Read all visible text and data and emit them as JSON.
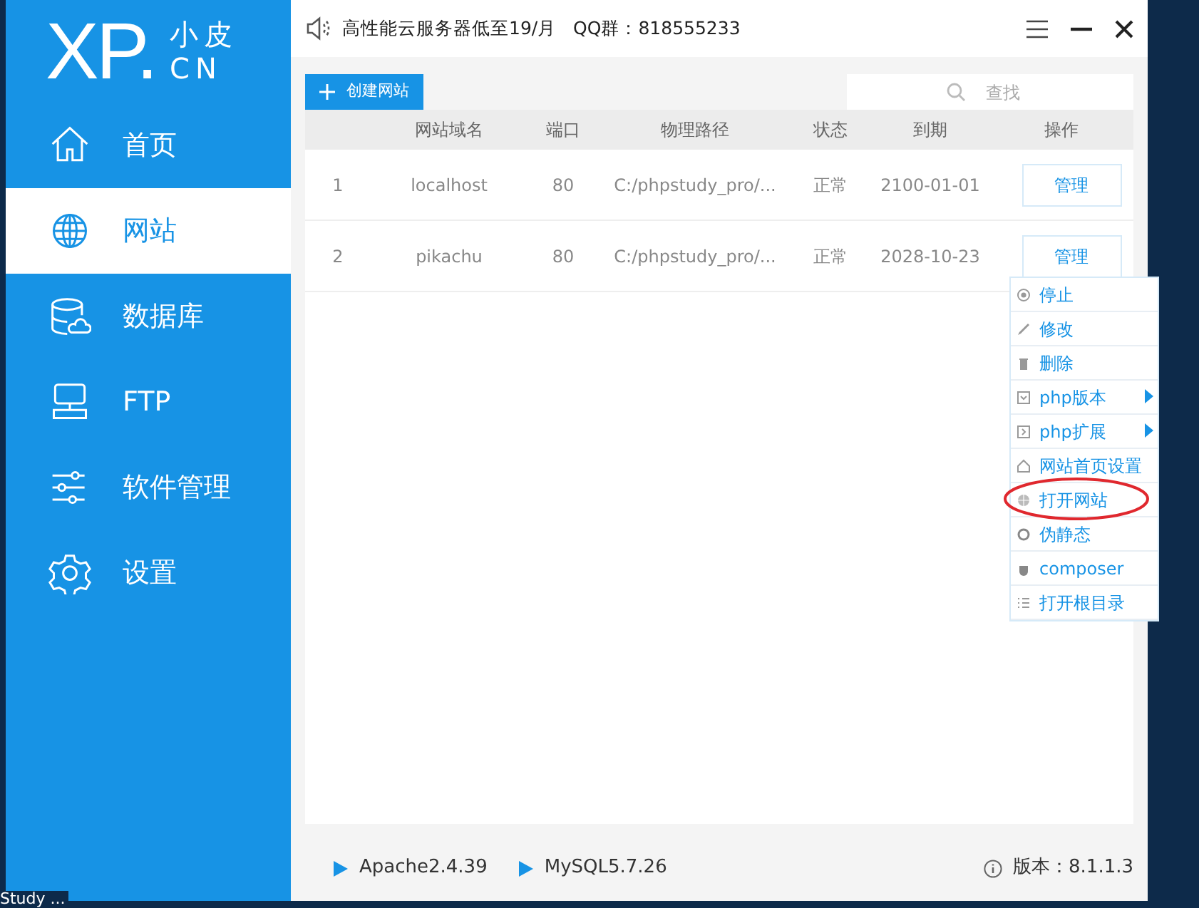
{
  "desktop": {
    "label": "Study ..."
  },
  "sidebar": {
    "logo": {
      "main": "XP.",
      "top": "小皮",
      "bottom": "CN"
    },
    "items": [
      {
        "label": "首页",
        "selected": false
      },
      {
        "label": "网站",
        "selected": true
      },
      {
        "label": "数据库",
        "selected": false
      },
      {
        "label": "FTP",
        "selected": false
      },
      {
        "label": "软件管理",
        "selected": false
      },
      {
        "label": "设置",
        "selected": false
      }
    ]
  },
  "header": {
    "notice": "高性能云服务器低至19/月   QQ群：818555233"
  },
  "toolbar": {
    "create_button": "创建网站",
    "search": {
      "placeholder": "查找"
    }
  },
  "table": {
    "columns": [
      "",
      "网站域名",
      "端口",
      "物理路径",
      "状态",
      "到期",
      "操作"
    ],
    "rows": [
      {
        "cells": [
          "1",
          "localhost",
          "80",
          "C:/phpstudy_pro/...",
          "正常",
          "2100-01-01"
        ],
        "action": "管理"
      },
      {
        "cells": [
          "2",
          "pikachu",
          "80",
          "C:/phpstudy_pro/...",
          "正常",
          "2028-10-23"
        ],
        "action": "管理"
      }
    ]
  },
  "context_menu": {
    "items": [
      {
        "label": "停止",
        "submenu": false,
        "highlighted": false
      },
      {
        "label": "修改",
        "submenu": false,
        "highlighted": false
      },
      {
        "label": "删除",
        "submenu": false,
        "highlighted": false
      },
      {
        "label": "php版本",
        "submenu": true,
        "highlighted": false
      },
      {
        "label": "php扩展",
        "submenu": true,
        "highlighted": false
      },
      {
        "label": "网站首页设置",
        "submenu": false,
        "highlighted": false
      },
      {
        "label": "打开网站",
        "submenu": false,
        "highlighted": true
      },
      {
        "label": "伪静态",
        "submenu": false,
        "highlighted": false
      },
      {
        "label": "composer",
        "submenu": false,
        "highlighted": false
      },
      {
        "label": "打开根目录",
        "submenu": false,
        "highlighted": false
      }
    ]
  },
  "status_bar": {
    "services": [
      "Apache2.4.39",
      "MySQL5.7.26"
    ],
    "version": "版本：8.1.1.3"
  }
}
